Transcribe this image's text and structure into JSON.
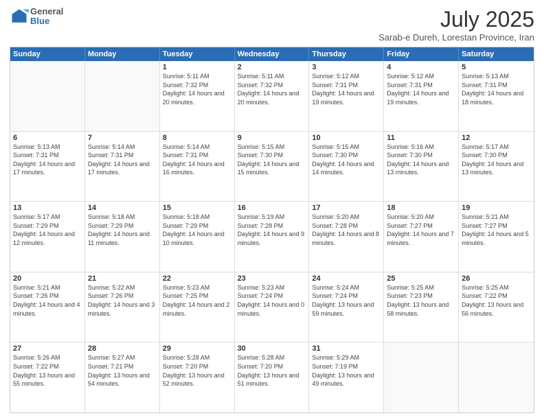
{
  "header": {
    "logo": {
      "general": "General",
      "blue": "Blue"
    },
    "month": "July 2025",
    "location": "Sarab-e Dureh, Lorestan Province, Iran"
  },
  "days_of_week": [
    "Sunday",
    "Monday",
    "Tuesday",
    "Wednesday",
    "Thursday",
    "Friday",
    "Saturday"
  ],
  "weeks": [
    [
      {
        "day": "",
        "sunrise": "",
        "sunset": "",
        "daylight": ""
      },
      {
        "day": "",
        "sunrise": "",
        "sunset": "",
        "daylight": ""
      },
      {
        "day": "1",
        "sunrise": "Sunrise: 5:11 AM",
        "sunset": "Sunset: 7:32 PM",
        "daylight": "Daylight: 14 hours and 20 minutes."
      },
      {
        "day": "2",
        "sunrise": "Sunrise: 5:11 AM",
        "sunset": "Sunset: 7:32 PM",
        "daylight": "Daylight: 14 hours and 20 minutes."
      },
      {
        "day": "3",
        "sunrise": "Sunrise: 5:12 AM",
        "sunset": "Sunset: 7:31 PM",
        "daylight": "Daylight: 14 hours and 19 minutes."
      },
      {
        "day": "4",
        "sunrise": "Sunrise: 5:12 AM",
        "sunset": "Sunset: 7:31 PM",
        "daylight": "Daylight: 14 hours and 19 minutes."
      },
      {
        "day": "5",
        "sunrise": "Sunrise: 5:13 AM",
        "sunset": "Sunset: 7:31 PM",
        "daylight": "Daylight: 14 hours and 18 minutes."
      }
    ],
    [
      {
        "day": "6",
        "sunrise": "Sunrise: 5:13 AM",
        "sunset": "Sunset: 7:31 PM",
        "daylight": "Daylight: 14 hours and 17 minutes."
      },
      {
        "day": "7",
        "sunrise": "Sunrise: 5:14 AM",
        "sunset": "Sunset: 7:31 PM",
        "daylight": "Daylight: 14 hours and 17 minutes."
      },
      {
        "day": "8",
        "sunrise": "Sunrise: 5:14 AM",
        "sunset": "Sunset: 7:31 PM",
        "daylight": "Daylight: 14 hours and 16 minutes."
      },
      {
        "day": "9",
        "sunrise": "Sunrise: 5:15 AM",
        "sunset": "Sunset: 7:30 PM",
        "daylight": "Daylight: 14 hours and 15 minutes."
      },
      {
        "day": "10",
        "sunrise": "Sunrise: 5:15 AM",
        "sunset": "Sunset: 7:30 PM",
        "daylight": "Daylight: 14 hours and 14 minutes."
      },
      {
        "day": "11",
        "sunrise": "Sunrise: 5:16 AM",
        "sunset": "Sunset: 7:30 PM",
        "daylight": "Daylight: 14 hours and 13 minutes."
      },
      {
        "day": "12",
        "sunrise": "Sunrise: 5:17 AM",
        "sunset": "Sunset: 7:30 PM",
        "daylight": "Daylight: 14 hours and 13 minutes."
      }
    ],
    [
      {
        "day": "13",
        "sunrise": "Sunrise: 5:17 AM",
        "sunset": "Sunset: 7:29 PM",
        "daylight": "Daylight: 14 hours and 12 minutes."
      },
      {
        "day": "14",
        "sunrise": "Sunrise: 5:18 AM",
        "sunset": "Sunset: 7:29 PM",
        "daylight": "Daylight: 14 hours and 11 minutes."
      },
      {
        "day": "15",
        "sunrise": "Sunrise: 5:18 AM",
        "sunset": "Sunset: 7:29 PM",
        "daylight": "Daylight: 14 hours and 10 minutes."
      },
      {
        "day": "16",
        "sunrise": "Sunrise: 5:19 AM",
        "sunset": "Sunset: 7:28 PM",
        "daylight": "Daylight: 14 hours and 9 minutes."
      },
      {
        "day": "17",
        "sunrise": "Sunrise: 5:20 AM",
        "sunset": "Sunset: 7:28 PM",
        "daylight": "Daylight: 14 hours and 8 minutes."
      },
      {
        "day": "18",
        "sunrise": "Sunrise: 5:20 AM",
        "sunset": "Sunset: 7:27 PM",
        "daylight": "Daylight: 14 hours and 7 minutes."
      },
      {
        "day": "19",
        "sunrise": "Sunrise: 5:21 AM",
        "sunset": "Sunset: 7:27 PM",
        "daylight": "Daylight: 14 hours and 5 minutes."
      }
    ],
    [
      {
        "day": "20",
        "sunrise": "Sunrise: 5:21 AM",
        "sunset": "Sunset: 7:26 PM",
        "daylight": "Daylight: 14 hours and 4 minutes."
      },
      {
        "day": "21",
        "sunrise": "Sunrise: 5:22 AM",
        "sunset": "Sunset: 7:26 PM",
        "daylight": "Daylight: 14 hours and 3 minutes."
      },
      {
        "day": "22",
        "sunrise": "Sunrise: 5:23 AM",
        "sunset": "Sunset: 7:25 PM",
        "daylight": "Daylight: 14 hours and 2 minutes."
      },
      {
        "day": "23",
        "sunrise": "Sunrise: 5:23 AM",
        "sunset": "Sunset: 7:24 PM",
        "daylight": "Daylight: 14 hours and 0 minutes."
      },
      {
        "day": "24",
        "sunrise": "Sunrise: 5:24 AM",
        "sunset": "Sunset: 7:24 PM",
        "daylight": "Daylight: 13 hours and 59 minutes."
      },
      {
        "day": "25",
        "sunrise": "Sunrise: 5:25 AM",
        "sunset": "Sunset: 7:23 PM",
        "daylight": "Daylight: 13 hours and 58 minutes."
      },
      {
        "day": "26",
        "sunrise": "Sunrise: 5:25 AM",
        "sunset": "Sunset: 7:22 PM",
        "daylight": "Daylight: 13 hours and 56 minutes."
      }
    ],
    [
      {
        "day": "27",
        "sunrise": "Sunrise: 5:26 AM",
        "sunset": "Sunset: 7:22 PM",
        "daylight": "Daylight: 13 hours and 55 minutes."
      },
      {
        "day": "28",
        "sunrise": "Sunrise: 5:27 AM",
        "sunset": "Sunset: 7:21 PM",
        "daylight": "Daylight: 13 hours and 54 minutes."
      },
      {
        "day": "29",
        "sunrise": "Sunrise: 5:28 AM",
        "sunset": "Sunset: 7:20 PM",
        "daylight": "Daylight: 13 hours and 52 minutes."
      },
      {
        "day": "30",
        "sunrise": "Sunrise: 5:28 AM",
        "sunset": "Sunset: 7:20 PM",
        "daylight": "Daylight: 13 hours and 51 minutes."
      },
      {
        "day": "31",
        "sunrise": "Sunrise: 5:29 AM",
        "sunset": "Sunset: 7:19 PM",
        "daylight": "Daylight: 13 hours and 49 minutes."
      },
      {
        "day": "",
        "sunrise": "",
        "sunset": "",
        "daylight": ""
      },
      {
        "day": "",
        "sunrise": "",
        "sunset": "",
        "daylight": ""
      }
    ]
  ]
}
